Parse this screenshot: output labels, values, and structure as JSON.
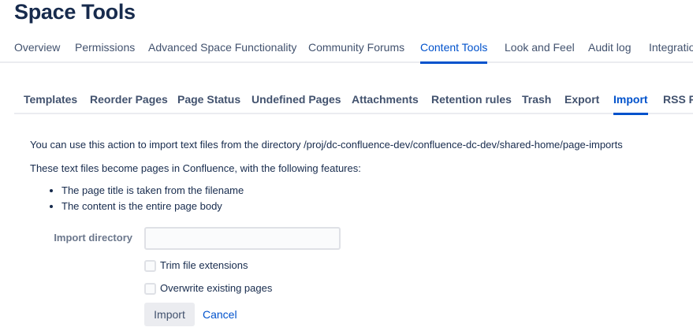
{
  "title": "Space Tools",
  "top_tabs": [
    "Overview",
    "Permissions",
    "Advanced Space Functionality",
    "Community Forums",
    "Content Tools",
    "Look and Feel",
    "Audit log",
    "Integrations"
  ],
  "sub_tabs": [
    "Templates",
    "Reorder Pages",
    "Page Status",
    "Undefined Pages",
    "Attachments",
    "Retention rules",
    "Trash",
    "Export",
    "Import",
    "RSS Feeds"
  ],
  "intro": "You can use this action to import text files from the directory /proj/dc-confluence-dev/confluence-dc-dev/shared-home/page-imports",
  "features_intro": "These text files become pages in Confluence, with the following features:",
  "features": [
    "The page title is taken from the filename",
    "The content is the entire page body"
  ],
  "form": {
    "dir_label": "Import directory",
    "dir_value": "",
    "trim_label": "Trim file extensions",
    "trim_checked": false,
    "overwrite_label": "Overwrite existing pages",
    "overwrite_checked": false,
    "import_label": "Import",
    "cancel_label": "Cancel"
  }
}
